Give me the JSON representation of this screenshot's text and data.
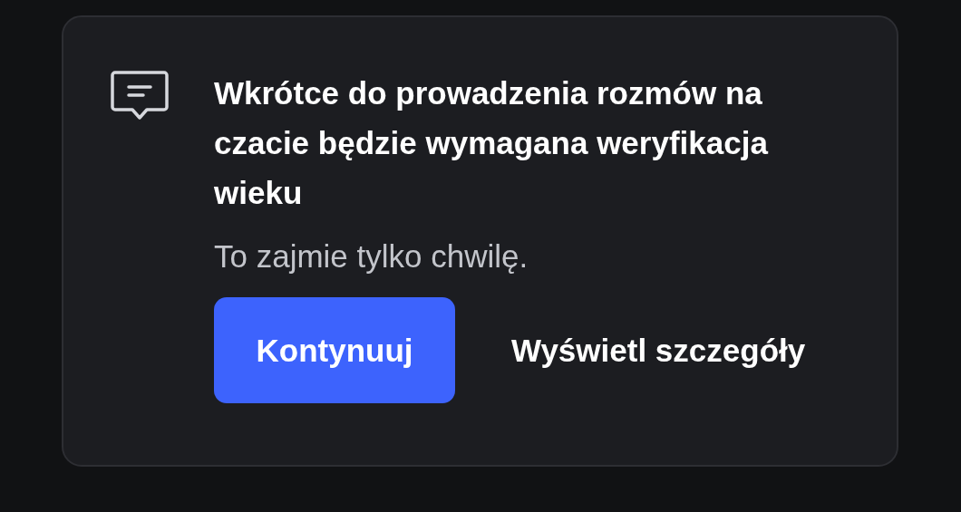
{
  "notice": {
    "title": "Wkrótce do prowadzenia rozmów na czacie będzie wymagana weryfikacja wieku",
    "subtitle": "To zajmie tylko chwilę.",
    "buttons": [
      {
        "label": "Kontynuuj",
        "kind": "primary"
      },
      {
        "label": "Wyświetl szczegóły",
        "kind": "link"
      }
    ]
  }
}
